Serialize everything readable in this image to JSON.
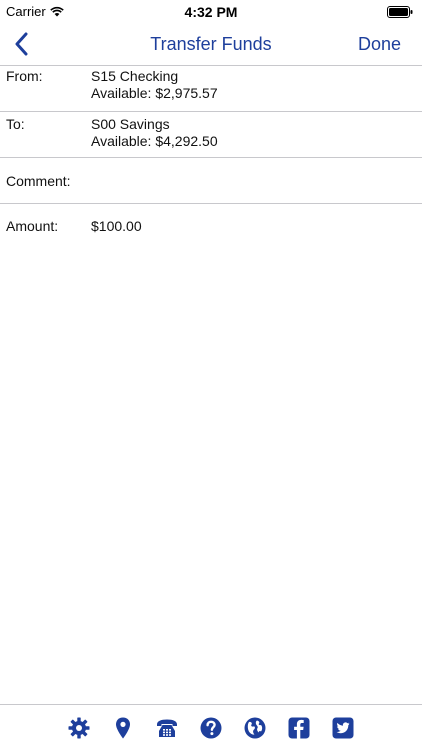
{
  "status_bar": {
    "carrier": "Carrier",
    "time": "4:32 PM"
  },
  "nav": {
    "title": "Transfer Funds",
    "done_label": "Done",
    "back_icon": "chevron-left-icon"
  },
  "form": {
    "from": {
      "label": "From:",
      "account": "S15 Checking",
      "available": "Available: $2,975.57"
    },
    "to": {
      "label": "To:",
      "account": "S00 Savings",
      "available": "Available: $4,292.50"
    },
    "comment": {
      "label": "Comment:",
      "value": ""
    },
    "amount": {
      "label": "Amount:",
      "value": "$100.00"
    }
  },
  "tab_bar": {
    "icons": [
      "gear-icon",
      "map-pin-icon",
      "telephone-icon",
      "help-icon",
      "globe-icon",
      "facebook-icon",
      "twitter-icon"
    ]
  },
  "colors": {
    "accent": "#1e3f9c",
    "separator": "#c8c8cc",
    "text": "#111111"
  }
}
